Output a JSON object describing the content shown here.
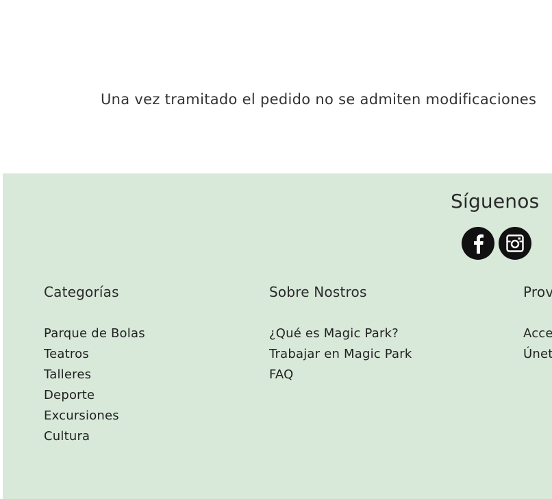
{
  "notice": {
    "text": "Una vez tramitado el pedido no se admiten modificaciones"
  },
  "footer": {
    "follow_title": "Síguenos",
    "social": [
      {
        "icon": "facebook-icon"
      },
      {
        "icon": "instagram-icon"
      }
    ],
    "columns": [
      {
        "title": "Categorías",
        "items": [
          "Parque de Bolas",
          "Teatros",
          "Talleres",
          "Deporte",
          "Excursiones",
          "Cultura"
        ]
      },
      {
        "title": "Sobre Nostros",
        "items": [
          "¿Qué es Magic Park?",
          "Trabajar en Magic Park",
          "FAQ"
        ]
      },
      {
        "title": "Prov",
        "items": [
          "Acce",
          "Únet"
        ]
      }
    ]
  }
}
